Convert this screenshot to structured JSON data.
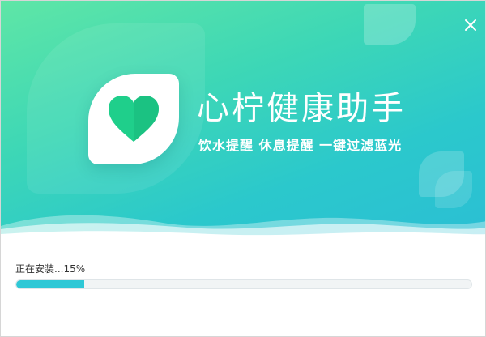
{
  "app": {
    "title": "心柠健康助手",
    "slogan": "饮水提醒  休息提醒  一键过滤蓝光"
  },
  "window": {
    "close_icon": "close-icon"
  },
  "logo": {
    "icon": "heart-icon",
    "color": "#20cc8a"
  },
  "install": {
    "status": "正在安装...15%",
    "progress_percent": 15
  },
  "colors": {
    "gradient_start": "#5fe6a6",
    "gradient_end": "#2bbfd4",
    "progress_fill": "#2ec8d6"
  }
}
